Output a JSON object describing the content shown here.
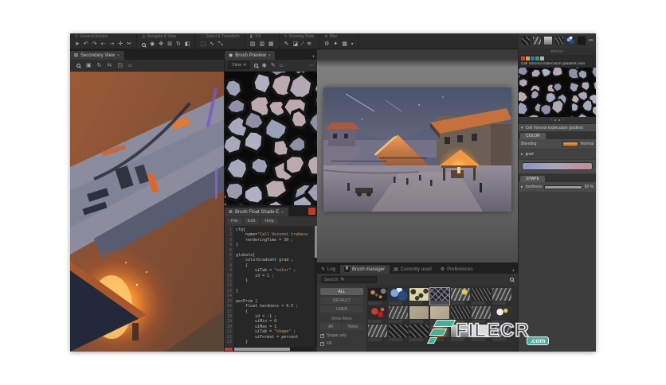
{
  "toolbar": {
    "groups": [
      {
        "label": "General Actions",
        "label_icon": "✎",
        "icons": [
          {
            "name": "pointer-icon",
            "glyph": "➤"
          },
          {
            "name": "undo-icon",
            "glyph": "↶"
          },
          {
            "name": "redo-icon",
            "glyph": "↷"
          },
          {
            "name": "history-back-icon",
            "glyph": "⇠"
          },
          {
            "name": "history-forward-icon",
            "glyph": "⇢"
          },
          {
            "name": "move-icon",
            "glyph": "✛"
          },
          {
            "name": "cut-icon",
            "glyph": "✂"
          }
        ]
      },
      {
        "label": "Navigate & View",
        "label_icon": "◎",
        "icons": [
          {
            "name": "zoom-icon",
            "glyph": "",
            "cls": "mag"
          },
          {
            "name": "orbit-icon",
            "glyph": "◉"
          },
          {
            "name": "pan-icon",
            "glyph": "✥"
          },
          {
            "name": "fit-view-icon",
            "glyph": "⊞"
          },
          {
            "name": "rotate-view-icon",
            "glyph": "↻"
          },
          {
            "name": "mirror-view-icon",
            "glyph": "◧"
          }
        ]
      },
      {
        "label": "Select & Transform",
        "label_icon": "⬚",
        "icons": [
          {
            "name": "rect-select-icon",
            "glyph": "⬚"
          },
          {
            "name": "lasso-icon",
            "glyph": "∿"
          },
          {
            "name": "transform-icon",
            "glyph": "⤡"
          }
        ]
      },
      {
        "label": "Fill",
        "label_icon": "◧",
        "icons": [
          {
            "name": "fill-icon",
            "glyph": "▨"
          },
          {
            "name": "gradient-icon",
            "glyph": "▥"
          },
          {
            "name": "pattern-icon",
            "glyph": "▦"
          }
        ]
      },
      {
        "label": "Drawing Tools",
        "label_icon": "✎",
        "icons": [
          {
            "name": "brush-icon",
            "glyph": "✎"
          },
          {
            "name": "eraser-icon",
            "glyph": "◪"
          },
          {
            "name": "line-icon",
            "glyph": "∕"
          },
          {
            "name": "smudge-icon",
            "glyph": "≋"
          }
        ]
      },
      {
        "label": "Misc",
        "label_icon": "★",
        "icons": [
          {
            "name": "settings-icon",
            "glyph": "⚙"
          },
          {
            "name": "effects-icon",
            "glyph": "✦"
          },
          {
            "name": "grid-icon",
            "glyph": "▦"
          },
          {
            "name": "snap-icon",
            "glyph": "▪"
          }
        ]
      }
    ]
  },
  "secondary_view": {
    "tab": "Secondary View",
    "tab_icon": "⊠",
    "caret": "▾",
    "toolbar_icons": [
      {
        "name": "zoom-icon",
        "glyph": "",
        "cls": "mag"
      },
      {
        "name": "fit-icon",
        "glyph": "▣"
      },
      {
        "name": "rotate-icon",
        "glyph": "↻"
      },
      {
        "name": "mirror-icon",
        "glyph": "⇆"
      },
      {
        "name": "actual-size-icon",
        "glyph": "◳"
      },
      {
        "name": "home-icon",
        "glyph": "⌂"
      }
    ]
  },
  "brush_preview": {
    "tab": "Brush Preview",
    "tab_icon": "◉",
    "caret": "▾",
    "view_label": "View",
    "toolbar_icons": [
      {
        "name": "zoom-icon",
        "glyph": "",
        "cls": "mag"
      },
      {
        "name": "orbit-icon",
        "glyph": "◉"
      },
      {
        "name": "draw-icon",
        "glyph": "✎"
      },
      {
        "name": "home-icon",
        "glyph": "⌂"
      }
    ],
    "options_button": "⋯"
  },
  "shader_editor": {
    "tab": "Brush Float Shade E",
    "tab_icon": "≣",
    "caret": "▾",
    "menus": [
      "File",
      "Edit",
      "Help"
    ],
    "code_lines": [
      "cfg{",
      "    name=\"Cell Voronoi trabecu",
      "    renderingTime = 30 ;",
      "}",
      "",
      "globals{",
      "    colorGradient grad ;",
      "    {",
      "        uiTab = \"color\" ;",
      "        id = 1 ;",
      "    }",
      "",
      "}",
      "",
      "perPrim {",
      "    float hardness = 0.5 ;",
      "    {",
      "        id = -1 ;",
      "        uiMin = 0",
      "        uiMax = 1",
      "        uiTab = \"shape\" ;",
      "        uiFormat = percent",
      "    }"
    ]
  },
  "brush_manager": {
    "tabs": [
      {
        "label": "Log",
        "icon": "✎",
        "active": false
      },
      {
        "label": "Brush manager",
        "icon": "V",
        "active": true
      },
      {
        "label": "Currently used",
        "icon": "▤",
        "active": false
      },
      {
        "label": "Preferences",
        "icon": "⚙",
        "active": false
      }
    ],
    "add_tab": "+",
    "search_placeholder": "Search",
    "filters": {
      "buttons": [
        {
          "label": "ALL",
          "active": true
        },
        {
          "label": "DEFAULT",
          "active": false
        },
        {
          "label": "USER",
          "active": false
        }
      ],
      "section_label": "Mime filters",
      "all_label": "All",
      "none_label": "None",
      "checkboxes": [
        {
          "label": "Shape only",
          "checked": true
        },
        {
          "label": "Fill",
          "checked": true
        }
      ]
    },
    "thumbs": [
      {
        "style": "t-speckle",
        "selected": false
      },
      {
        "style": "t-camo",
        "selected": false
      },
      {
        "style": "t-cells",
        "selected": false
      },
      {
        "style": "t-vor",
        "selected": true
      },
      {
        "style": "t-strokes-y",
        "selected": false
      },
      {
        "style": "t-hatch",
        "selected": false
      },
      {
        "style": "t-strokes",
        "selected": false
      },
      {
        "style": "t-splat-red",
        "selected": false
      },
      {
        "style": "t-strokes",
        "selected": false
      },
      {
        "style": "t-flat1",
        "selected": false
      },
      {
        "style": "t-flat2",
        "selected": false
      },
      {
        "style": "t-hatch",
        "selected": false
      },
      {
        "style": "t-strokes",
        "selected": false
      },
      {
        "style": "t-splat-white",
        "selected": false
      },
      {
        "style": "t-strokes",
        "selected": false
      },
      {
        "style": "t-weave",
        "selected": false
      },
      {
        "style": "t-weave",
        "selected": false
      },
      {
        "style": "t-orange",
        "selected": false
      },
      {
        "style": "t-photo",
        "selected": false
      },
      {
        "style": "t-white",
        "selected": false
      },
      {
        "style": "t-strokes",
        "selected": false
      }
    ]
  },
  "inspector": {
    "header_label": "BRUSH",
    "mini_thumbs": [
      "t-weave",
      "t-strokes",
      "t-photo",
      "t-hatch",
      "t-camo",
      "t-dark"
    ],
    "pen_icon": "✏",
    "logo_colors": [
      "#d04030",
      "#e0a030",
      "#3070c0",
      "#30a060",
      "#b0b0b0"
    ],
    "title": "Cell Voronoi trabeculum gradient varo",
    "pagination_prev": "‹",
    "pagination_next": "›",
    "collapse_caret": "▾",
    "collapse_label": "Cell Voronoi trabeculum gradient",
    "color_tab": "COLOR",
    "blending_label": "Blending",
    "blending_value": "Normal",
    "grad_caret": "▸",
    "grad_label": "grad",
    "shape_tab": "SHAPE",
    "hardness_caret": "▸",
    "hardness_label": "hardness",
    "hardness_value": "50 %"
  },
  "watermark": {
    "text": "FILECR",
    "suffix": ".com",
    "color": "#45b39d"
  },
  "colors": {
    "cells": [
      "#a8a8bc",
      "#9b9bb0",
      "#b3a9b6",
      "#bdaab0",
      "#9aa0b5",
      "#b0b0c2",
      "#8f8fa5"
    ],
    "accent_orange": "#d97a35",
    "gradient_bar": [
      "#8d93c4",
      "#a9a6bd",
      "#bb93a0"
    ]
  }
}
